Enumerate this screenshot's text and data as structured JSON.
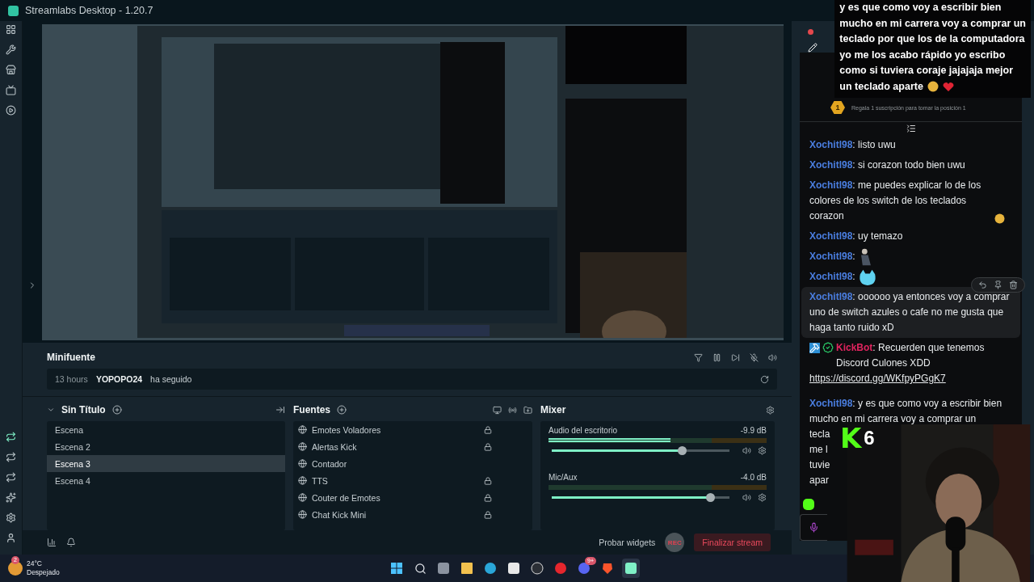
{
  "window": {
    "title": "Streamlabs Desktop - 1.20.7"
  },
  "minifuente": {
    "title": "Minifuente",
    "events": [
      {
        "time": "13 hours",
        "user": "YOPOPO24",
        "action": "ha seguido"
      }
    ]
  },
  "scenes": {
    "title": "Sin Título",
    "items": [
      {
        "label": "Escena",
        "selected": false
      },
      {
        "label": "Escena 2",
        "selected": false
      },
      {
        "label": "Escena 3",
        "selected": true
      },
      {
        "label": "Escena 4",
        "selected": false
      }
    ]
  },
  "sources": {
    "title": "Fuentes",
    "items": [
      {
        "label": "Emotes Voladores",
        "locked": true
      },
      {
        "label": "Alertas Kick",
        "locked": true
      },
      {
        "label": "Contador",
        "locked": false
      },
      {
        "label": "TTS",
        "locked": true
      },
      {
        "label": "Couter de Emotes",
        "locked": true
      },
      {
        "label": "Chat Kick Mini",
        "locked": true
      }
    ]
  },
  "mixer": {
    "title": "Mixer",
    "channels": [
      {
        "name": "Audio del escritorio",
        "reading": "-9.9 dB",
        "meter": {
          "level": 0.56
        },
        "volume": {
          "level": 0.73
        }
      },
      {
        "name": "Mic/Aux",
        "reading": "-4.0 dB",
        "volume": {
          "level": 0.89
        }
      }
    ]
  },
  "footer": {
    "test_widgets": "Probar widgets",
    "rec": "REC",
    "end_stream": "Finalizar stream"
  },
  "overlay_message": {
    "text": "y es que como voy a escribir bien\nmucho en mi carrera voy a comprar un\nteclado por que los de la computadora\nyo me los acabo rápido yo escribo\ncomo si tuviera coraje jajajaja mejor",
    "last_line": "un teclado aparte"
  },
  "chat": {
    "gift_banner": {
      "rank": "1",
      "text": "Regala 1 suscripción para tomar la posición 1"
    },
    "messages": [
      {
        "user": "Xochitl98",
        "separator": ":",
        "color": "#4a7ee0",
        "kind": "text",
        "text": "listo uwu",
        "hovered": false
      },
      {
        "user": "Xochitl98",
        "separator": ":",
        "color": "#4a7ee0",
        "kind": "text",
        "text": "si corazon todo bien uwu",
        "hovered": false
      },
      {
        "user": "Xochitl98",
        "separator": ":",
        "color": "#4a7ee0",
        "kind": "text-emoji",
        "text": "me puedes explicar lo de los colores de los switch de los teclados corazon",
        "hovered": false
      },
      {
        "user": "Xochitl98",
        "separator": ":",
        "color": "#4a7ee0",
        "kind": "text",
        "text": "uy temazo",
        "hovered": false
      },
      {
        "user": "Xochitl98",
        "separator": ":",
        "color": "#4a7ee0",
        "kind": "figure-emote",
        "hovered": false
      },
      {
        "user": "Xochitl98",
        "separator": ":",
        "color": "#4a7ee0",
        "kind": "blob-emote",
        "hovered": false
      },
      {
        "user": "Xochitl98",
        "separator": ":",
        "color": "#4a7ee0",
        "kind": "text",
        "text": "oooooo ya entonces voy a comprar uno de switch azules o cafe no me gusta que haga tanto ruido xD",
        "hovered": true
      },
      {
        "user": "KickBot",
        "separator": ":",
        "color": "#e0245e",
        "kind": "bot",
        "text": "Recuerden que tenemos Discord Culones XDD",
        "link": "https://discord.gg/WKfpyPGgK7",
        "hovered": false
      },
      {
        "user": "Xochitl98",
        "separator": ":",
        "color": "#4a7ee0",
        "kind": "cut",
        "text": "y es que como voy a escribir bien mucho en mi carrera voy a comprar un",
        "cut_lines": [
          "tecla",
          "me l",
          "tuvie",
          "apar"
        ],
        "hovered": false
      }
    ]
  },
  "webcam": {
    "kind": "picture",
    "badge_letter": "K",
    "badge_count": "6"
  },
  "taskbar": {
    "weather_badge": "2",
    "temperature": "24°C",
    "condition": "Despejado",
    "discord_badge": "9+"
  }
}
